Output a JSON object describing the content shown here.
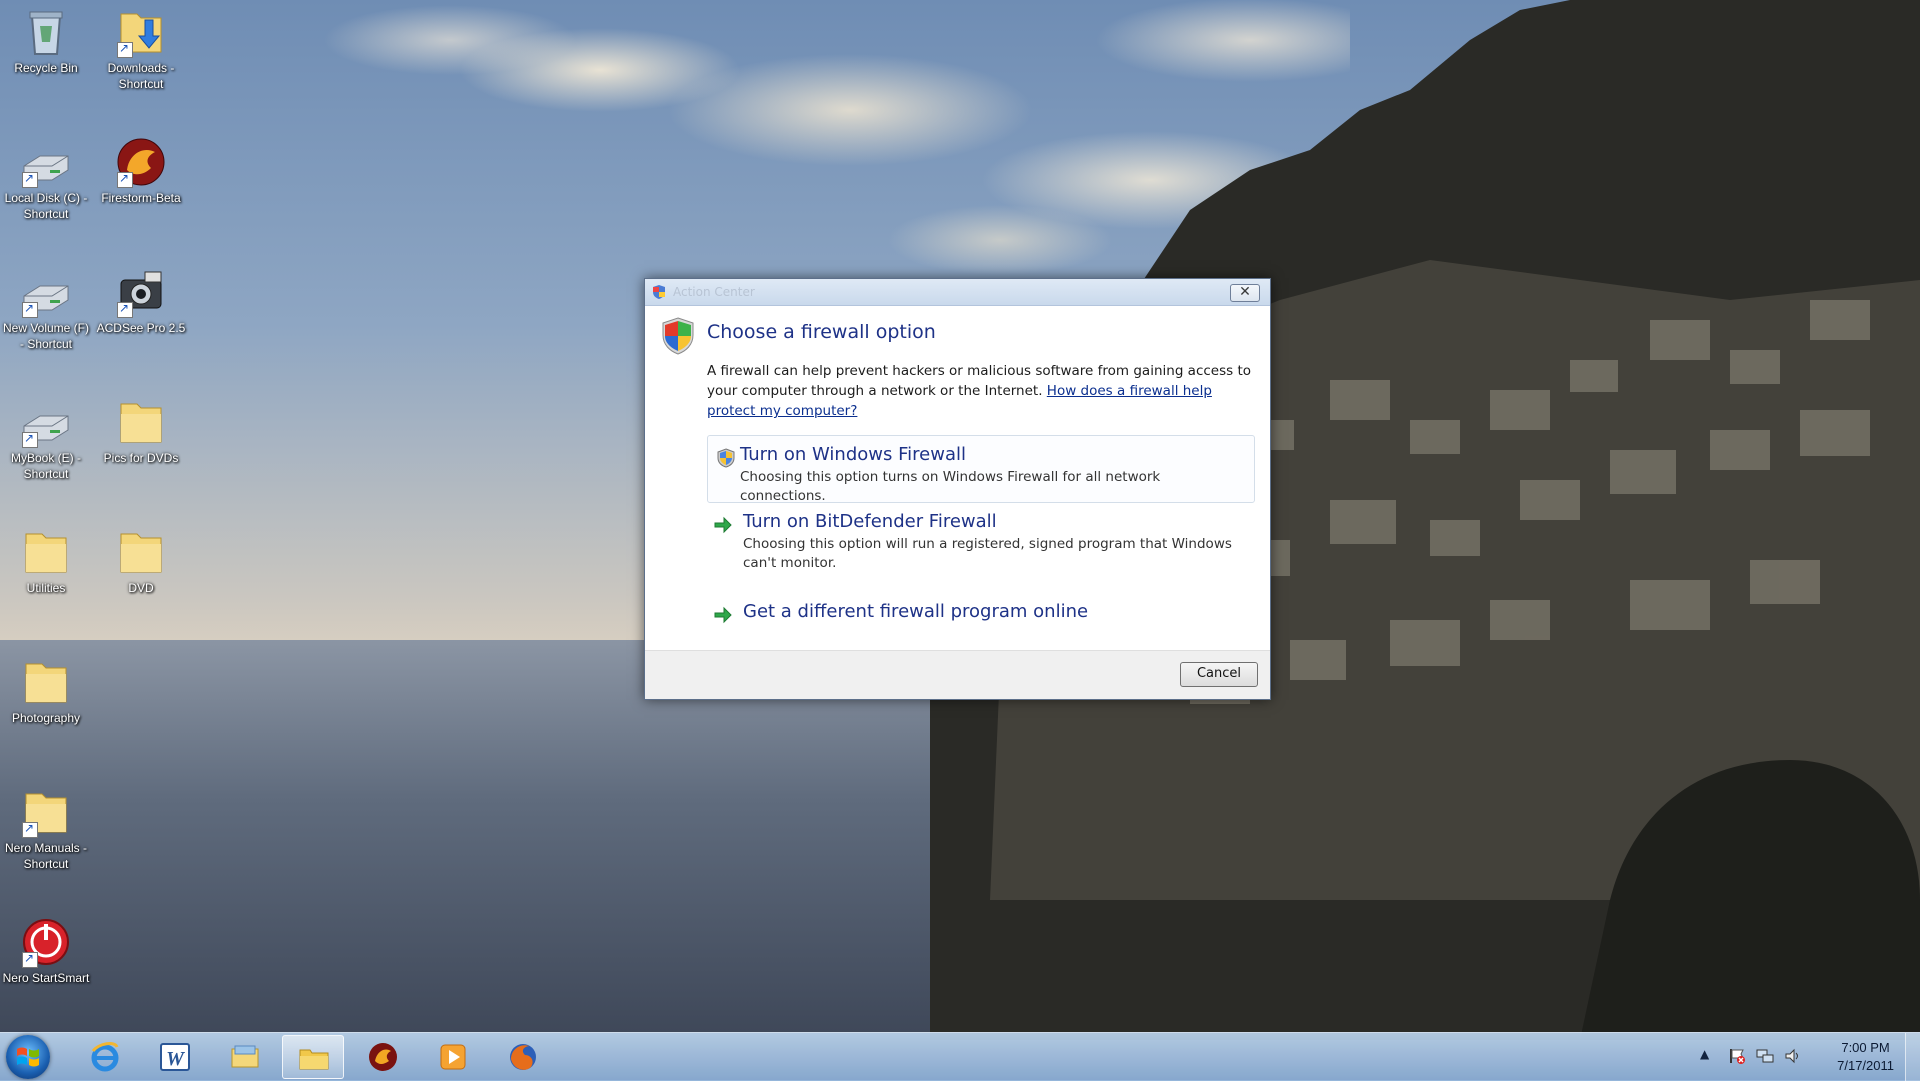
{
  "desktop": {
    "icons": [
      {
        "label": "Recycle Bin",
        "icon": "recycle-bin-icon"
      },
      {
        "label": "Downloads - Shortcut",
        "icon": "folder-downloads-icon"
      },
      {
        "label": "Local Disk (C) - Shortcut",
        "icon": "drive-icon"
      },
      {
        "label": "Firestorm-Beta",
        "icon": "firestorm-icon"
      },
      {
        "label": "New Volume (F) - Shortcut",
        "icon": "drive-icon"
      },
      {
        "label": "ACDSee Pro 2.5",
        "icon": "acdsee-icon"
      },
      {
        "label": "MyBook (E) - Shortcut",
        "icon": "drive-icon"
      },
      {
        "label": "Pics for DVDs",
        "icon": "folder-icon"
      },
      {
        "label": "Utilities",
        "icon": "folder-icon"
      },
      {
        "label": "DVD",
        "icon": "folder-icon"
      },
      {
        "label": "Photography",
        "icon": "folder-icon"
      },
      {
        "label": "Nero Manuals - Shortcut",
        "icon": "folder-icon"
      },
      {
        "label": "Nero StartSmart",
        "icon": "nero-startsmart-icon"
      }
    ]
  },
  "dialog": {
    "window_title": "Action Center",
    "heading": "Choose a firewall option",
    "description": "A firewall can help prevent hackers or malicious software from gaining access to your computer through a network or the Internet. ",
    "help_link": "How does a firewall help protect my computer?",
    "options": [
      {
        "title": "Turn on Windows Firewall",
        "desc": "Choosing this option turns on Windows Firewall for all network connections.",
        "icon": "shield-icon"
      },
      {
        "title": "Turn on BitDefender Firewall",
        "desc": "Choosing this option will run a registered, signed program that Windows can't monitor.",
        "icon": "green-arrow-icon"
      },
      {
        "title": "Get a different firewall program online",
        "desc": "",
        "icon": "green-arrow-icon"
      }
    ],
    "cancel_label": "Cancel"
  },
  "taskbar": {
    "items": [
      "internet-explorer-icon",
      "word-icon",
      "libraries-icon",
      "windows-explorer-icon",
      "firestorm-icon",
      "media-player-icon",
      "firefox-icon"
    ],
    "clock_time": "7:00 PM",
    "clock_date": "7/17/2011"
  },
  "colors": {
    "dialog_heading": "#1e3287",
    "link": "#0b2f8f",
    "taskbar": "#a8c3e2"
  }
}
